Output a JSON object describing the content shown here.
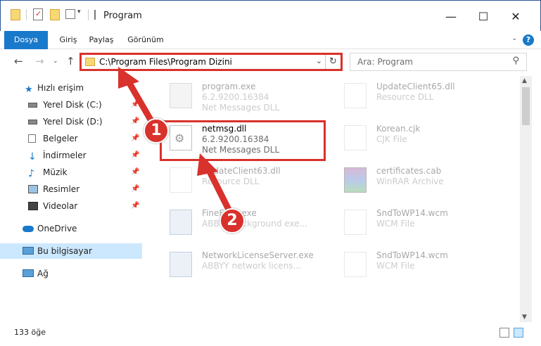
{
  "window": {
    "title": "Program",
    "minimize_icon": "minimize-icon",
    "maximize_icon": "maximize-icon",
    "close_icon": "close-icon"
  },
  "ribbon": {
    "tabs": [
      "Dosya",
      "Giriş",
      "Paylaş",
      "Görünüm"
    ],
    "help": "?"
  },
  "navigation": {
    "address_path": "C:\\Program Files\\Program Dizini",
    "search_placeholder": "Ara: Program"
  },
  "sidebar": {
    "items": [
      {
        "label": "Hızlı erişim",
        "icon": "star-icon"
      },
      {
        "label": "Yerel Disk (C:)",
        "icon": "drive-icon"
      },
      {
        "label": "Yerel Disk (D:)",
        "icon": "drive-icon"
      },
      {
        "label": "Belgeler",
        "icon": "documents-icon"
      },
      {
        "label": "İndirmeler",
        "icon": "download-icon"
      },
      {
        "label": "Müzik",
        "icon": "music-icon"
      },
      {
        "label": "Resimler",
        "icon": "pictures-icon"
      },
      {
        "label": "Videolar",
        "icon": "video-icon"
      },
      {
        "label": "OneDrive",
        "icon": "cloud-icon"
      },
      {
        "label": "Bu bilgisayar",
        "icon": "computer-icon"
      },
      {
        "label": "Ağ",
        "icon": "network-icon"
      }
    ]
  },
  "files": [
    {
      "name": "program.exe",
      "line2": "6.2.9200.16384",
      "line3": "Net Messages DLL"
    },
    {
      "name": "UpdateClient65.dll",
      "line2": "Resource DLL",
      "line3": ""
    },
    {
      "name": "netmsg.dll",
      "line2": "6.2.9200.16384",
      "line3": "Net Messages DLL"
    },
    {
      "name": "Korean.cjk",
      "line2": "CJK File",
      "line3": ""
    },
    {
      "name": "UpdateClient63.dll",
      "line2": "Resource DLL",
      "line3": ""
    },
    {
      "name": "certificates.cab",
      "line2": "WinRAR Archive",
      "line3": ""
    },
    {
      "name": "FineExec.exe",
      "line2": "ABBYY background exe...",
      "line3": ""
    },
    {
      "name": "SndToWP14.wcm",
      "line2": "WCM File",
      "line3": ""
    },
    {
      "name": "NetworkLicenseServer.exe",
      "line2": "ABBYY network licens...",
      "line3": ""
    },
    {
      "name": "SndToWP14.wcm",
      "line2": "WCM File",
      "line3": ""
    }
  ],
  "status": {
    "count": "133 öğe"
  },
  "annotations": [
    "1",
    "2"
  ],
  "colors": {
    "accent": "#1979ca",
    "highlight": "#d9312b",
    "selection": "#cce8ff"
  }
}
